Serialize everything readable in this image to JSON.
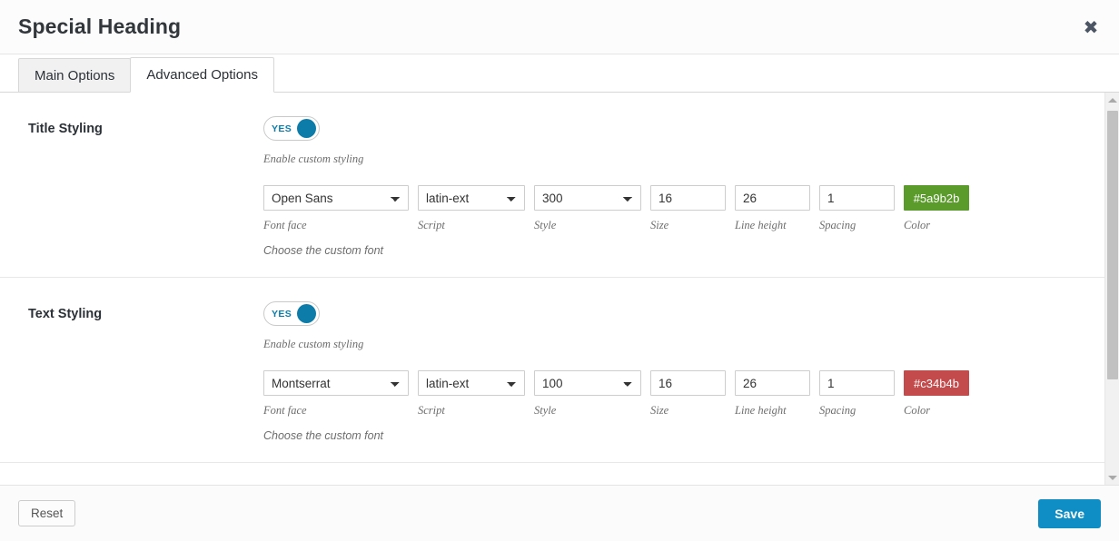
{
  "header": {
    "title": "Special Heading",
    "close_label": "✖"
  },
  "tabs": [
    {
      "label": "Main Options",
      "active": false
    },
    {
      "label": "Advanced Options",
      "active": true
    }
  ],
  "sections": [
    {
      "label": "Title Styling",
      "toggle": {
        "value": "YES",
        "on": true
      },
      "toggle_help": "Enable custom styling",
      "fields": [
        {
          "name": "font-face",
          "label": "Font face",
          "type": "select",
          "value": "Open Sans"
        },
        {
          "name": "script",
          "label": "Script",
          "type": "select",
          "value": "latin-ext"
        },
        {
          "name": "style",
          "label": "Style",
          "type": "select",
          "value": "300"
        },
        {
          "name": "size",
          "label": "Size",
          "type": "input",
          "value": "16"
        },
        {
          "name": "line-height",
          "label": "Line height",
          "type": "input",
          "value": "26"
        },
        {
          "name": "spacing",
          "label": "Spacing",
          "type": "input",
          "value": "1"
        },
        {
          "name": "color",
          "label": "Color",
          "type": "color",
          "value": "#5a9b2b",
          "swatch": "#5a9b2b"
        }
      ],
      "footer_help": "Choose the custom font"
    },
    {
      "label": "Text Styling",
      "toggle": {
        "value": "YES",
        "on": true
      },
      "toggle_help": "Enable custom styling",
      "fields": [
        {
          "name": "font-face",
          "label": "Font face",
          "type": "select",
          "value": "Montserrat"
        },
        {
          "name": "script",
          "label": "Script",
          "type": "select",
          "value": "latin-ext"
        },
        {
          "name": "style",
          "label": "Style",
          "type": "select",
          "value": "100"
        },
        {
          "name": "size",
          "label": "Size",
          "type": "input",
          "value": "16"
        },
        {
          "name": "line-height",
          "label": "Line height",
          "type": "input",
          "value": "26"
        },
        {
          "name": "spacing",
          "label": "Spacing",
          "type": "input",
          "value": "1"
        },
        {
          "name": "color",
          "label": "Color",
          "type": "color",
          "value": "#c34b4b",
          "swatch": "#c34b4b"
        }
      ],
      "footer_help": "Choose the custom font"
    }
  ],
  "footer": {
    "reset_label": "Reset",
    "save_label": "Save"
  },
  "colors": {
    "accent": "#0e8ec4",
    "toggle_on": "#0e7ca8",
    "title_color": "#5a9b2b",
    "text_color": "#c34b4b"
  }
}
